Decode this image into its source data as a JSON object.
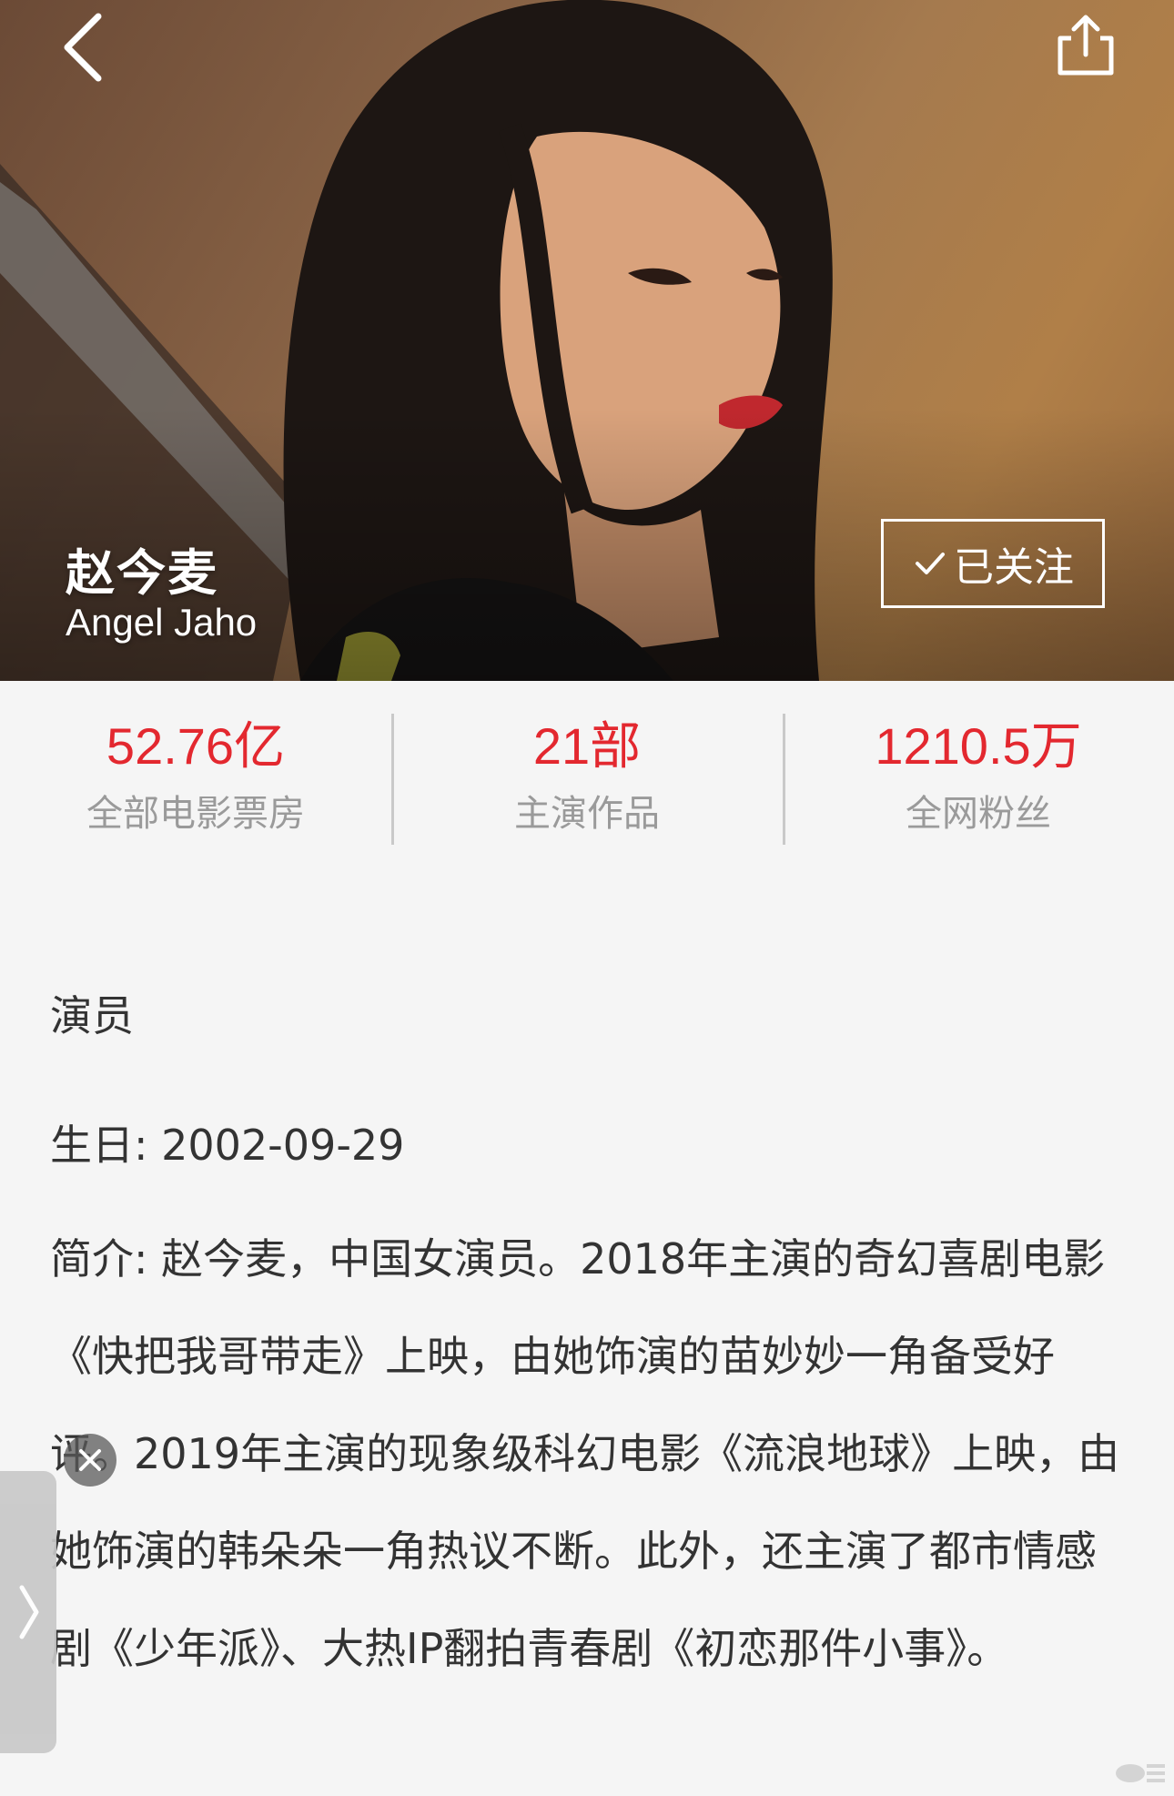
{
  "header": {
    "back_icon": "chevron-left-icon",
    "share_icon": "share-icon"
  },
  "actor": {
    "name_cn": "赵今麦",
    "name_en": "Angel Jaho",
    "follow_label": "已关注"
  },
  "stats": [
    {
      "value": "52.76亿",
      "label": "全部电影票房"
    },
    {
      "value": "21部",
      "label": "主演作品"
    },
    {
      "value": "1210.5万",
      "label": "全网粉丝"
    }
  ],
  "bio": {
    "profession": "演员",
    "birthday": "生日: 2002-09-29",
    "intro": "简介: 赵今麦，中国女演员。2018年主演的奇幻喜剧电影《快把我哥带走》上映，由她饰演的苗妙妙一角备受好评。2019年主演的现象级科幻电影《流浪地球》上映，由她饰演的韩朵朵一角热议不断。此外，还主演了都市情感剧《少年派》、大热IP翻拍青春剧《初恋那件小事》。"
  },
  "colors": {
    "accent": "#e3282f",
    "label_gray": "#9a9a9a",
    "text": "#333333",
    "background": "#f5f5f5"
  }
}
